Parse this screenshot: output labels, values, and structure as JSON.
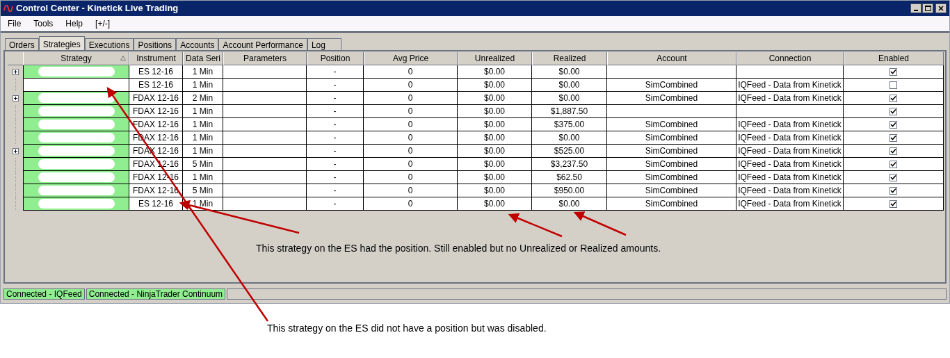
{
  "window": {
    "title": "Control Center - Kinetick Live Trading"
  },
  "menu": [
    "File",
    "Tools",
    "Help",
    "[+/-]"
  ],
  "tabs": [
    {
      "label": "Orders",
      "selected": false
    },
    {
      "label": "Strategies",
      "selected": true
    },
    {
      "label": "Executions",
      "selected": false
    },
    {
      "label": "Positions",
      "selected": false
    },
    {
      "label": "Accounts",
      "selected": false
    },
    {
      "label": "Account Performance",
      "selected": false
    },
    {
      "label": "Log",
      "selected": false
    }
  ],
  "table": {
    "columns": [
      {
        "label": "Strategy",
        "sorted": true
      },
      {
        "label": "Instrument",
        "sorted": false
      },
      {
        "label": "Data Seri",
        "sorted": false
      },
      {
        "label": "Parameters",
        "sorted": false
      },
      {
        "label": "Position",
        "sorted": false
      },
      {
        "label": "Avg Price",
        "sorted": false
      },
      {
        "label": "Unrealized",
        "sorted": false
      },
      {
        "label": "Realized",
        "sorted": false
      },
      {
        "label": "Account",
        "sorted": false
      },
      {
        "label": "Connection",
        "sorted": false
      },
      {
        "label": "Enabled",
        "sorted": false
      }
    ],
    "rows": [
      {
        "expandable": true,
        "instrument": "ES 12-16",
        "series": "1 Min",
        "position": "-",
        "avg_price": "0",
        "unrealized": "$0.00",
        "realized": "$0.00",
        "enabled": true
      },
      {
        "expandable": false,
        "instrument": "ES 12-16",
        "series": "1 Min",
        "position": "-",
        "avg_price": "0",
        "unrealized": "$0.00",
        "realized": "$0.00",
        "account": "SimCombined",
        "connection": "IQFeed - Data from Kinetick",
        "enabled": false
      },
      {
        "expandable": true,
        "instrument": "FDAX 12-16",
        "series": "2 Min",
        "position": "-",
        "avg_price": "0",
        "unrealized": "$0.00",
        "realized": "$0.00",
        "account": "SimCombined",
        "connection": "IQFeed - Data from Kinetick",
        "enabled": true
      },
      {
        "expandable": false,
        "instrument": "FDAX 12-16",
        "series": "1 Min",
        "position": "-",
        "avg_price": "0",
        "unrealized": "$0.00",
        "realized": "$1,887.50",
        "enabled": true
      },
      {
        "expandable": false,
        "instrument": "FDAX 12-16",
        "series": "1 Min",
        "position": "-",
        "avg_price": "0",
        "unrealized": "$0.00",
        "realized": "$375.00",
        "account": "SimCombined",
        "connection": "IQFeed - Data from Kinetick",
        "enabled": true
      },
      {
        "expandable": false,
        "instrument": "FDAX 12-16",
        "series": "1 Min",
        "position": "-",
        "avg_price": "0",
        "unrealized": "$0.00",
        "realized": "$0.00",
        "account": "SimCombined",
        "connection": "IQFeed - Data from Kinetick",
        "enabled": true
      },
      {
        "expandable": true,
        "instrument": "FDAX 12-16",
        "series": "1 Min",
        "position": "-",
        "avg_price": "0",
        "unrealized": "$0.00",
        "realized": "$525.00",
        "account": "SimCombined",
        "connection": "IQFeed - Data from Kinetick",
        "enabled": true
      },
      {
        "expandable": false,
        "instrument": "FDAX 12-16",
        "series": "5 Min",
        "position": "-",
        "avg_price": "0",
        "unrealized": "$0.00",
        "realized": "$3,237.50",
        "account": "SimCombined",
        "connection": "IQFeed - Data from Kinetick",
        "enabled": true
      },
      {
        "expandable": false,
        "instrument": "FDAX 12-16",
        "series": "1 Min",
        "position": "-",
        "avg_price": "0",
        "unrealized": "$0.00",
        "realized": "$62.50",
        "account": "SimCombined",
        "connection": "IQFeed - Data from Kinetick",
        "enabled": true
      },
      {
        "expandable": false,
        "instrument": "FDAX 12-16",
        "series": "5 Min",
        "position": "-",
        "avg_price": "0",
        "unrealized": "$0.00",
        "realized": "$950.00",
        "account": "SimCombined",
        "connection": "IQFeed - Data from Kinetick",
        "enabled": true
      },
      {
        "expandable": false,
        "instrument": "ES 12-16",
        "series": "1 Min",
        "position": "-",
        "avg_price": "0",
        "unrealized": "$0.00",
        "realized": "$0.00",
        "account": "SimCombined",
        "connection": "IQFeed - Data from Kinetick",
        "enabled": true
      }
    ]
  },
  "status_bar": [
    {
      "label": "Connected - IQFeed",
      "color": "#90ee90"
    },
    {
      "label": "Connected - NinjaTrader Continuum",
      "color": "#90ee90"
    }
  ],
  "annotations": [
    "This strategy on the ES had the position. Still enabled but no Unrealized or Realized amounts.",
    "This strategy on the ES did not have a position but was disabled."
  ]
}
